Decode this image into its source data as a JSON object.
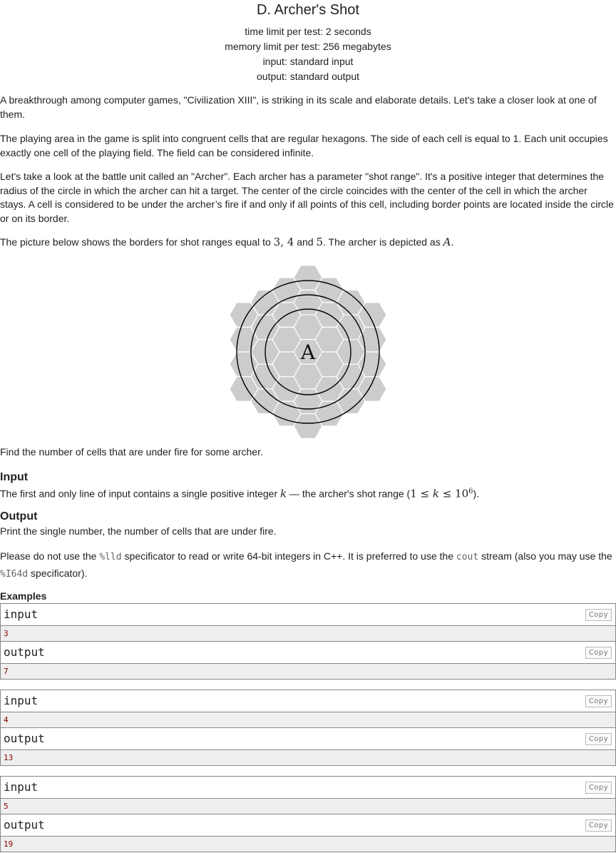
{
  "problem": {
    "title": "D. Archer's Shot",
    "time_limit": "time limit per test: 2 seconds",
    "memory_limit": "memory limit per test: 256 megabytes",
    "input_file": "input: standard input",
    "output_file": "output: standard output"
  },
  "statement": {
    "p1": "A breakthrough among computer games, \"Civilization XIII\", is striking in its scale and elaborate details. Let's take a closer look at one of them.",
    "p2": "The playing area in the game is split into congruent cells that are regular hexagons. The side of each cell is equal to 1. Each unit occupies exactly one cell of the playing field. The field can be considered infinite.",
    "p3": "Let's take a look at the battle unit called an \"Archer\". Each archer has a parameter \"shot range\". It's a positive integer that determines the radius of the circle in which the archer can hit a target. The center of the circle coincides with the center of the cell in which the archer stays. A cell is considered to be under the archer’s fire if and only if all points of this cell, including border points are located inside the circle or on its border.",
    "p4_prefix": "The picture below shows the borders for shot ranges equal to ",
    "p4_v1": "3",
    "p4_sep1": ", ",
    "p4_v2": "4",
    "p4_and": " and ",
    "p4_v3": "5",
    "p4_mid": ". The archer is depicted as ",
    "p4_var": "A",
    "p4_end": ".",
    "figure_label": "A",
    "p5": "Find the number of cells that are under fire for some archer."
  },
  "input_section": {
    "title": "Input",
    "text_prefix": "The first and only line of input contains a single positive integer ",
    "var_k": "k",
    "text_mid": " — the archer's shot range (",
    "constraint_main": "1 ≤ ",
    "constraint_k": "k",
    "constraint_le": " ≤ 10",
    "constraint_exp": "6",
    "text_end": ")."
  },
  "output_section": {
    "title": "Output",
    "text": "Print the single number, the number of cells that are under fire."
  },
  "note": {
    "part1": "Please do not use the ",
    "code1": "%lld",
    "part2": " specificator to read or write 64-bit integers in C++. It is preferred to use the ",
    "code2": "cout",
    "part3": " stream (also you may use the ",
    "code3": "%I64d",
    "part4": " specificator)."
  },
  "examples": {
    "label": "Examples",
    "input_label": "input",
    "output_label": "output",
    "copy_label": "Copy",
    "tests": [
      {
        "input": "3",
        "output": "7"
      },
      {
        "input": "4",
        "output": "13"
      },
      {
        "input": "5",
        "output": "19"
      }
    ]
  },
  "colors": {
    "hex_fill": "#cccccc",
    "hex_stroke": "#ffffff",
    "circle_stroke": "#000000"
  }
}
